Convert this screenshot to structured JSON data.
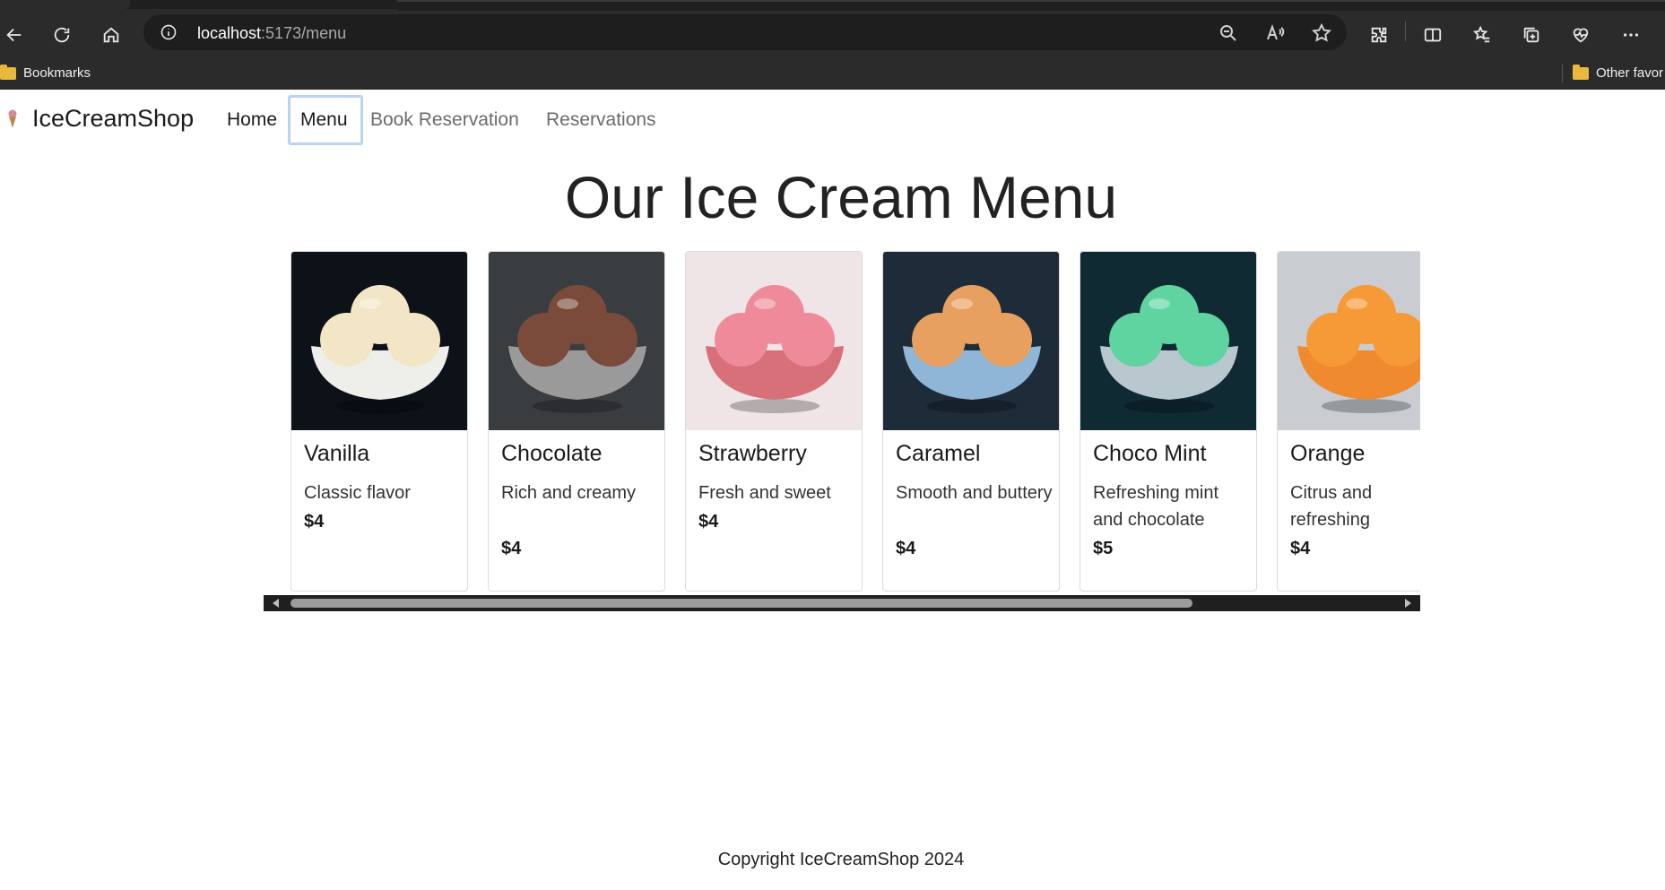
{
  "browser": {
    "url_host": "localhost",
    "url_path": ":5173/menu",
    "bookmarks_label": "Bookmarks",
    "other_favorites_label": "Other favor"
  },
  "nav": {
    "brand": "IceCreamShop",
    "links": [
      "Home",
      "Menu",
      "Book Reservation",
      "Reservations"
    ]
  },
  "page": {
    "title": "Our Ice Cream Menu",
    "footer": "Copyright IceCreamShop 2024"
  },
  "menu": [
    {
      "name": "Vanilla",
      "description": "Classic flavor",
      "price": "$4",
      "colors": {
        "bg": "#0d1218",
        "scoop": "#f2e6c6",
        "bowl": "#eeeeea"
      }
    },
    {
      "name": "Chocolate",
      "description": "Rich and creamy",
      "price": "$4",
      "colors": {
        "bg": "#3a3d40",
        "scoop": "#7a4b3a",
        "bowl": "#9a9a9a"
      }
    },
    {
      "name": "Strawberry",
      "description": "Fresh and sweet",
      "price": "$4",
      "colors": {
        "bg": "#efe4e6",
        "scoop": "#ef8a9a",
        "bowl": "#d8707a"
      }
    },
    {
      "name": "Caramel",
      "description": "Smooth and buttery",
      "price": "$4",
      "colors": {
        "bg": "#1e2b38",
        "scoop": "#e8a060",
        "bowl": "#8fb6d6"
      }
    },
    {
      "name": "Choco Mint",
      "description": "Refreshing mint and chocolate",
      "price": "$5",
      "colors": {
        "bg": "#0f2a33",
        "scoop": "#5fd3a0",
        "bowl": "#b9c7cf"
      }
    },
    {
      "name": "Orange",
      "description": "Citrus and refreshing",
      "price": "$4",
      "colors": {
        "bg": "#c9cdd1",
        "scoop": "#f59a36",
        "bowl": "#f08a2e"
      }
    }
  ]
}
